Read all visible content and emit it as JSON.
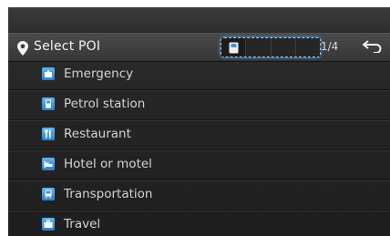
{
  "header": {
    "title": "Select POI",
    "page_indicator": "1/4",
    "back_icon": "back-arrow-icon",
    "category_slots": [
      {
        "icon": "fuel-pump-icon",
        "active": true
      },
      {
        "icon": "",
        "active": false
      },
      {
        "icon": "",
        "active": false
      },
      {
        "icon": "",
        "active": false
      }
    ]
  },
  "list": {
    "items": [
      {
        "label": "Emergency",
        "icon": "emergency-icon"
      },
      {
        "label": "Petrol station",
        "icon": "fuel-pump-icon"
      },
      {
        "label": "Restaurant",
        "icon": "fork-knife-icon"
      },
      {
        "label": "Hotel or motel",
        "icon": "bed-icon"
      },
      {
        "label": "Transportation",
        "icon": "transport-icon"
      },
      {
        "label": "Travel",
        "icon": "suitcase-icon"
      }
    ]
  },
  "colors": {
    "accent": "#8fd0ff",
    "icon_bg": "#3f97dc",
    "text": "#d4d4d4"
  }
}
